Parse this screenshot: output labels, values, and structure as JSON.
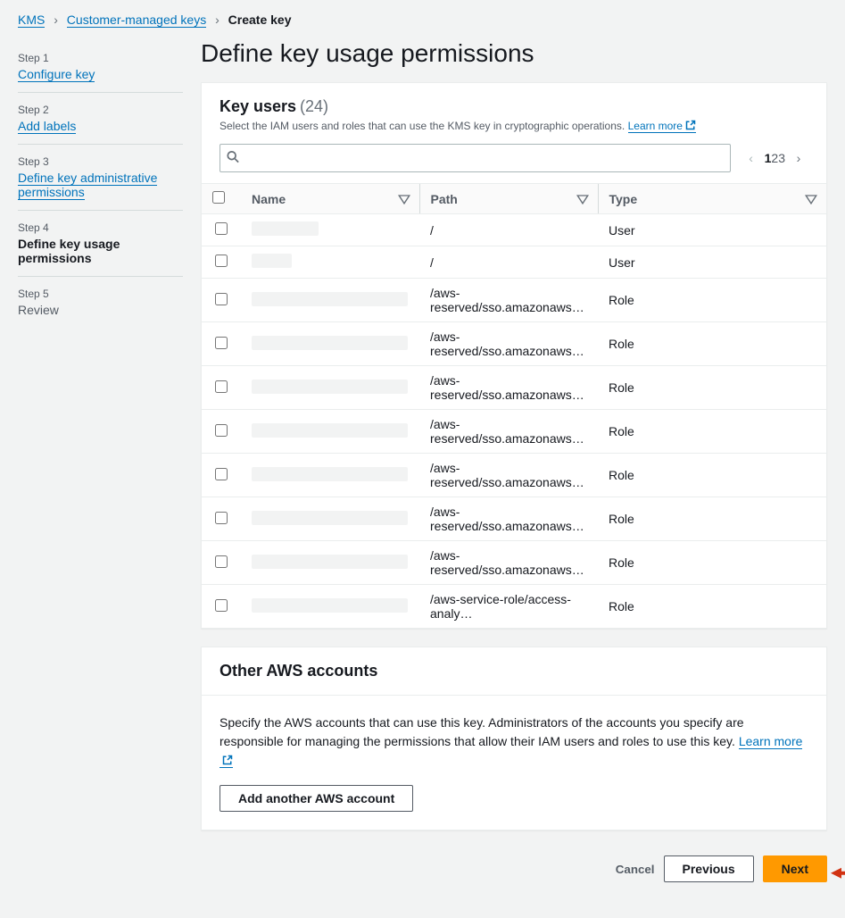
{
  "breadcrumb": {
    "root": "KMS",
    "mid": "Customer-managed keys",
    "current": "Create key"
  },
  "steps": [
    {
      "label": "Step 1",
      "title": "Configure key",
      "state": "link"
    },
    {
      "label": "Step 2",
      "title": "Add labels",
      "state": "link"
    },
    {
      "label": "Step 3",
      "title": "Define key administrative permissions",
      "state": "link"
    },
    {
      "label": "Step 4",
      "title": "Define key usage permissions",
      "state": "current"
    },
    {
      "label": "Step 5",
      "title": "Review",
      "state": "future"
    }
  ],
  "page_title": "Define key usage permissions",
  "key_users": {
    "title": "Key users",
    "count": "(24)",
    "desc": "Select the IAM users and roles that can use the KMS key in cryptographic operations.",
    "learn_more": "Learn more",
    "pages": [
      "1",
      "2",
      "3"
    ],
    "current_page": 1,
    "columns": {
      "name": "Name",
      "path": "Path",
      "type": "Type"
    },
    "rows": [
      {
        "name_width": 75,
        "path": "/",
        "type": "User"
      },
      {
        "name_width": 45,
        "path": "/",
        "type": "User"
      },
      {
        "name_width": 175,
        "path": "/aws-reserved/sso.amazonaws…",
        "type": "Role"
      },
      {
        "name_width": 175,
        "path": "/aws-reserved/sso.amazonaws…",
        "type": "Role"
      },
      {
        "name_width": 175,
        "path": "/aws-reserved/sso.amazonaws…",
        "type": "Role"
      },
      {
        "name_width": 175,
        "path": "/aws-reserved/sso.amazonaws…",
        "type": "Role"
      },
      {
        "name_width": 175,
        "path": "/aws-reserved/sso.amazonaws…",
        "type": "Role"
      },
      {
        "name_width": 175,
        "path": "/aws-reserved/sso.amazonaws…",
        "type": "Role"
      },
      {
        "name_width": 175,
        "path": "/aws-reserved/sso.amazonaws…",
        "type": "Role"
      },
      {
        "name_width": 175,
        "path": "/aws-service-role/access-analy…",
        "type": "Role"
      }
    ]
  },
  "other_accounts": {
    "title": "Other AWS accounts",
    "desc": "Specify the AWS accounts that can use this key. Administrators of the accounts you specify are responsible for managing the permissions that allow their IAM users and roles to use this key.",
    "learn_more": "Learn more",
    "add_button": "Add another AWS account"
  },
  "footer": {
    "cancel": "Cancel",
    "previous": "Previous",
    "next": "Next"
  }
}
